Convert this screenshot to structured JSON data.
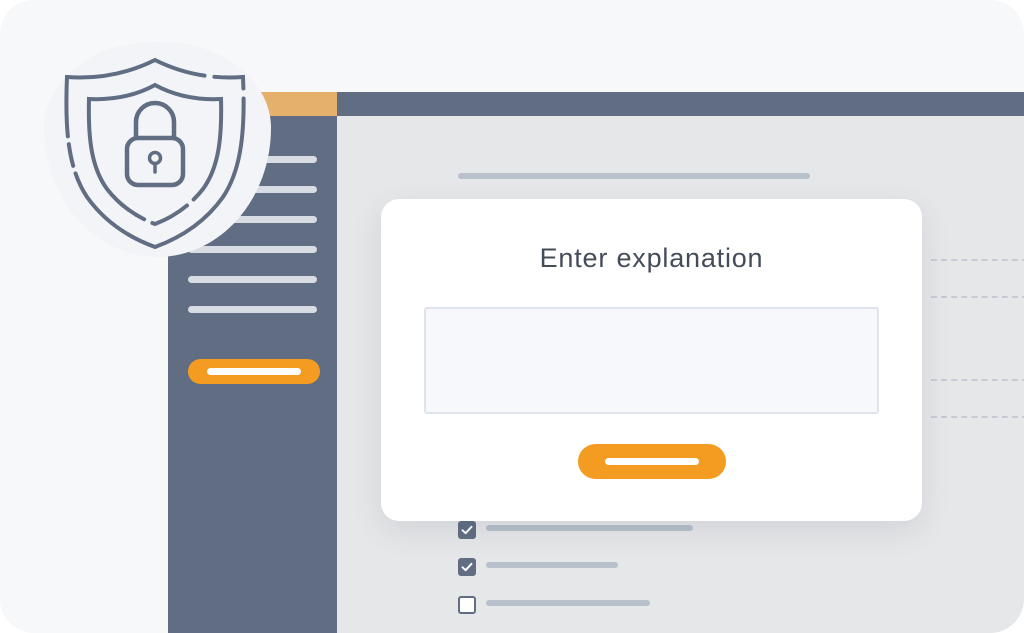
{
  "modal": {
    "title": "Enter explanation",
    "input_value": "",
    "submit_button_label": ""
  },
  "sidebar": {
    "items": [
      "",
      "",
      "",
      "",
      "",
      ""
    ],
    "action_button_label": ""
  },
  "checklist": [
    {
      "checked": true,
      "label": ""
    },
    {
      "checked": true,
      "label": ""
    },
    {
      "checked": false,
      "label": ""
    }
  ],
  "icons": {
    "shield": "shield-lock-icon",
    "check": "checkmark-icon"
  },
  "colors": {
    "accent": "#f39c21",
    "accent_soft": "#e5b06b",
    "sidebar": "#606d83",
    "content_bg": "#e6e7e9",
    "text": "#444c5a"
  }
}
